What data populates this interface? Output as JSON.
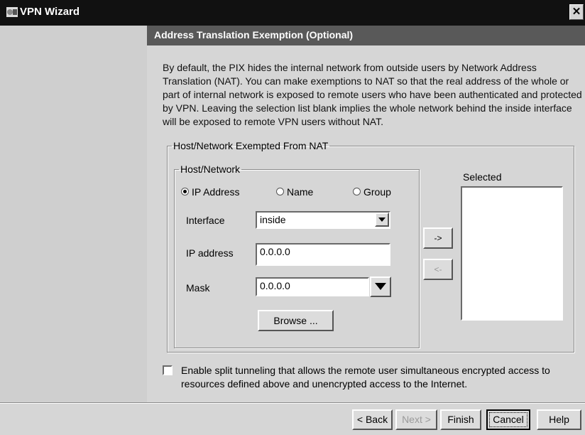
{
  "window": {
    "title": "VPN Wizard",
    "close_label": "✕"
  },
  "header": {
    "title": "Address Translation Exemption (Optional)"
  },
  "description": "By default, the PIX hides the internal network from outside users by Network Address Translation (NAT). You can make exemptions to NAT so that the real address of the whole or part of internal network is exposed to remote users who have been authenticated and protected by VPN. Leaving the selection list blank implies the whole network behind the inside interface will be exposed to remote VPN users without NAT.",
  "exempt_group": {
    "legend": "Host/Network Exempted From NAT",
    "host_group": {
      "legend": "Host/Network",
      "radios": [
        {
          "label": "IP Address",
          "checked": true
        },
        {
          "label": "Name",
          "checked": false
        },
        {
          "label": "Group",
          "checked": false
        }
      ],
      "interface_label": "Interface",
      "interface_value": "inside",
      "ip_label": "IP address",
      "ip_value": "0.0.0.0",
      "mask_label": "Mask",
      "mask_value": "0.0.0.0",
      "browse_label": "Browse ..."
    },
    "add_label": "->",
    "remove_label": "<-",
    "selected_label": "Selected"
  },
  "split_tunnel": {
    "checked": false,
    "label": "Enable split tunneling that allows the remote user simultaneous encrypted access to resources defined above and unencrypted access to the Internet."
  },
  "footer": {
    "back_label": "< Back",
    "next_label": "Next >",
    "finish_label": "Finish",
    "cancel_label": "Cancel",
    "help_label": "Help"
  }
}
